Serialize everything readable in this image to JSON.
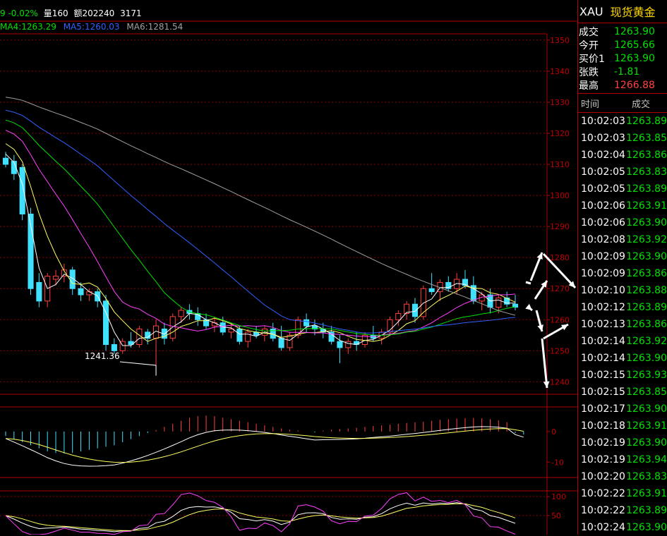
{
  "header": {
    "change_text": "9 -0.02%",
    "volume_text": "量160",
    "amount_text": "额202240",
    "extra_text": "3171"
  },
  "ma_line": {
    "ma4": "MA4:1263.29",
    "ma5": "MA5:1260.03",
    "ma6": "MA6:1281.54"
  },
  "quote": {
    "symbol": "XAU",
    "name": "现货黄金",
    "rows": [
      {
        "label": "成交",
        "value": "1263.90",
        "color": "#00e000"
      },
      {
        "label": "今开",
        "value": "1265.66",
        "color": "#00e000"
      },
      {
        "label": "买价1",
        "value": "1263.90",
        "color": "#00e000"
      },
      {
        "label": "张跌",
        "value": "-1.81",
        "color": "#00e000"
      },
      {
        "label": "最高",
        "value": "1266.88",
        "color": "#ff4040"
      }
    ],
    "ticks_header": {
      "time": "时间",
      "price": "成交"
    },
    "ticks": [
      {
        "time": "10:02:03",
        "price": "1263.89"
      },
      {
        "time": "10:02:03",
        "price": "1263.85"
      },
      {
        "time": "10:02:04",
        "price": "1263.86"
      },
      {
        "time": "10:02:05",
        "price": "1263.83"
      },
      {
        "time": "10:02:05",
        "price": "1263.89"
      },
      {
        "time": "10:02:06",
        "price": "1263.91"
      },
      {
        "time": "10:02:06",
        "price": "1263.90"
      },
      {
        "time": "10:02:08",
        "price": "1263.92"
      },
      {
        "time": "10:02:09",
        "price": "1263.90"
      },
      {
        "time": "10:02:09",
        "price": "1263.86"
      },
      {
        "time": "10:02:10",
        "price": "1263.88"
      },
      {
        "time": "10:02:12",
        "price": "1263.89"
      },
      {
        "time": "10:02:13",
        "price": "1263.86"
      },
      {
        "time": "10:02:14",
        "price": "1263.92"
      },
      {
        "time": "10:02:14",
        "price": "1263.90"
      },
      {
        "time": "10:02:15",
        "price": "1263.93"
      },
      {
        "time": "10:02:15",
        "price": "1263.85"
      },
      {
        "time": "10:02:17",
        "price": "1263.90"
      },
      {
        "time": "10:02:18",
        "price": "1263.91"
      },
      {
        "time": "10:02:19",
        "price": "1263.90"
      },
      {
        "time": "10:02:19",
        "price": "1263.94"
      },
      {
        "time": "10:02:20",
        "price": "1263.83"
      },
      {
        "time": "10:02:22",
        "price": "1263.91"
      },
      {
        "time": "10:02:22",
        "price": "1263.89"
      },
      {
        "time": "10:02:24",
        "price": "1263.90"
      }
    ]
  },
  "chart_data": [
    {
      "type": "candlestick",
      "y_ticks": [
        "1350",
        "1340",
        "1330",
        "1320",
        "1310",
        "1300",
        "1290",
        "1280",
        "1270",
        "1260",
        "1250",
        "1240"
      ],
      "ylim": [
        1236,
        1352
      ],
      "grid": true,
      "low_label": "1241.36",
      "candles": [
        [
          1312,
          1314,
          1309,
          1310
        ],
        [
          1311,
          1313,
          1305,
          1307
        ],
        [
          1309,
          1310,
          1292,
          1294
        ],
        [
          1294,
          1296,
          1268,
          1270
        ],
        [
          1272,
          1275,
          1264,
          1266
        ],
        [
          1266,
          1275,
          1264,
          1274
        ],
        [
          1273,
          1276,
          1271,
          1274
        ],
        [
          1274,
          1278,
          1272,
          1276
        ],
        [
          1276,
          1277,
          1268,
          1270
        ],
        [
          1270,
          1272,
          1266,
          1268
        ],
        [
          1268,
          1270,
          1266,
          1269
        ],
        [
          1269,
          1270,
          1264,
          1266
        ],
        [
          1266,
          1268,
          1250,
          1252
        ],
        [
          1252,
          1254,
          1249,
          1250
        ],
        [
          1250,
          1254,
          1249,
          1253
        ],
        [
          1253,
          1256,
          1251,
          1252
        ],
        [
          1252,
          1258,
          1251,
          1257
        ],
        [
          1256,
          1257,
          1252,
          1254
        ],
        [
          1254,
          1260,
          1242,
          1258
        ],
        [
          1257,
          1259,
          1252,
          1254
        ],
        [
          1254,
          1262,
          1253,
          1261
        ],
        [
          1261,
          1264,
          1259,
          1263
        ],
        [
          1263,
          1265,
          1260,
          1262
        ],
        [
          1262,
          1264,
          1258,
          1260
        ],
        [
          1260,
          1262,
          1257,
          1258
        ],
        [
          1258,
          1261,
          1256,
          1259
        ],
        [
          1259,
          1261,
          1255,
          1256
        ],
        [
          1256,
          1259,
          1254,
          1257
        ],
        [
          1257,
          1258,
          1252,
          1253
        ],
        [
          1253,
          1257,
          1251,
          1256
        ],
        [
          1256,
          1258,
          1254,
          1255
        ],
        [
          1255,
          1258,
          1253,
          1257
        ],
        [
          1257,
          1259,
          1253,
          1254
        ],
        [
          1254,
          1258,
          1250,
          1251
        ],
        [
          1251,
          1256,
          1250,
          1255
        ],
        [
          1255,
          1261,
          1254,
          1260
        ],
        [
          1260,
          1262,
          1256,
          1258
        ],
        [
          1258,
          1260,
          1255,
          1257
        ],
        [
          1257,
          1259,
          1254,
          1256
        ],
        [
          1256,
          1258,
          1252,
          1253
        ],
        [
          1253,
          1255,
          1246,
          1251
        ],
        [
          1251,
          1254,
          1249,
          1253
        ],
        [
          1253,
          1256,
          1250,
          1252
        ],
        [
          1252,
          1256,
          1251,
          1255
        ],
        [
          1255,
          1258,
          1253,
          1254
        ],
        [
          1254,
          1257,
          1252,
          1256
        ],
        [
          1256,
          1261,
          1255,
          1260
        ],
        [
          1260,
          1263,
          1258,
          1262
        ],
        [
          1262,
          1266,
          1260,
          1265
        ],
        [
          1265,
          1267,
          1259,
          1261
        ],
        [
          1261,
          1271,
          1260,
          1270
        ],
        [
          1270,
          1275,
          1268,
          1269
        ],
        [
          1269,
          1273,
          1266,
          1272
        ],
        [
          1272,
          1274,
          1269,
          1270
        ],
        [
          1270,
          1275,
          1268,
          1273
        ],
        [
          1273,
          1276,
          1270,
          1271
        ],
        [
          1271,
          1274,
          1265,
          1266
        ],
        [
          1266,
          1269,
          1263,
          1268
        ],
        [
          1268,
          1270,
          1262,
          1264
        ],
        [
          1264,
          1268,
          1262,
          1267
        ],
        [
          1267,
          1269,
          1264,
          1265
        ],
        [
          1265,
          1268,
          1263,
          1264
        ]
      ]
    },
    {
      "type": "bar",
      "y_ticks": [
        "0",
        "-10"
      ],
      "ylim": [
        -15,
        8
      ],
      "values": [
        -1.5,
        -2.5,
        -3.5,
        -4.5,
        -5.5,
        -6.5,
        -7,
        -7.2,
        -7,
        -6.5,
        -6,
        -5.5,
        -5,
        -4.5,
        -3.5,
        -2.5,
        -1.5,
        -0.5,
        0.5,
        1.5,
        2.5,
        3.5,
        4.5,
        5,
        5.2,
        5,
        4.5,
        4,
        3.5,
        3,
        2.5,
        2,
        1.5,
        1,
        0.6,
        0.3,
        0,
        -0.3,
        0.3,
        0.6,
        0.8,
        1,
        1.2,
        1.5,
        1.8,
        2,
        2.2,
        2.5,
        2.8,
        3,
        3.2,
        3.5,
        3.8,
        4,
        4.2,
        4.3,
        4.4,
        4.3,
        4,
        3.6,
        3,
        -0.5,
        -1
      ]
    },
    {
      "type": "line",
      "y_ticks": [
        "100",
        "50"
      ],
      "ylim": [
        0,
        115
      ],
      "grid": true
    }
  ]
}
